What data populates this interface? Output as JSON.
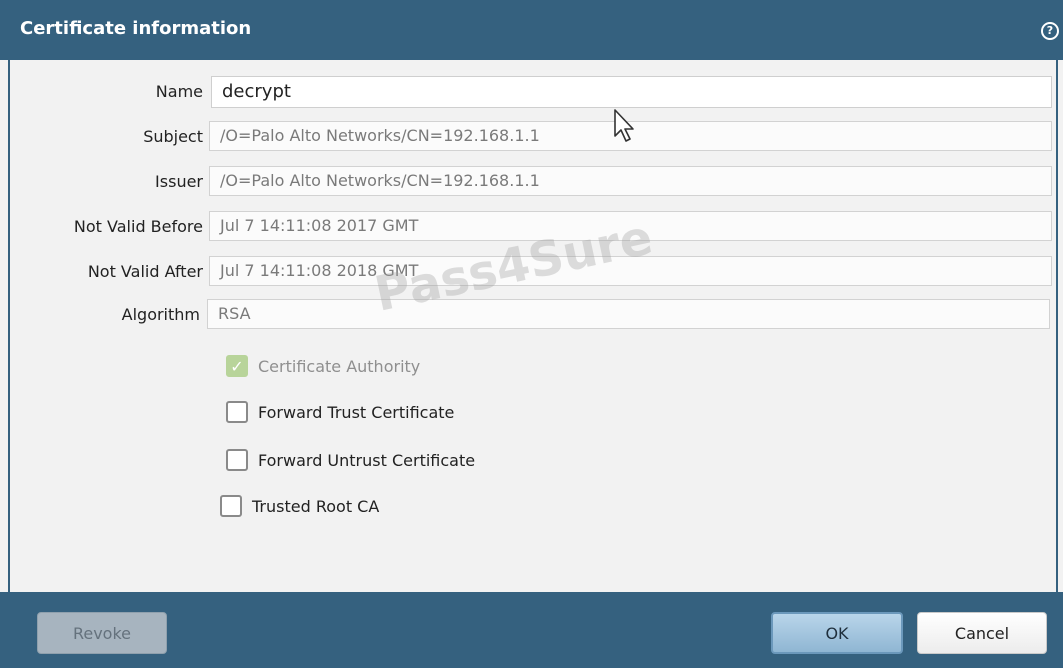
{
  "dialog": {
    "title": "Certificate information",
    "help_icon": "help-circle-icon"
  },
  "fields": {
    "name": {
      "label": "Name",
      "value": "decrypt"
    },
    "subject": {
      "label": "Subject",
      "value": "/O=Palo Alto Networks/CN=192.168.1.1"
    },
    "issuer": {
      "label": "Issuer",
      "value": "/O=Palo Alto Networks/CN=192.168.1.1"
    },
    "not_valid_before": {
      "label": "Not Valid Before",
      "value": "Jul 7 14:11:08 2017 GMT"
    },
    "not_valid_after": {
      "label": "Not Valid After",
      "value": "Jul 7 14:11:08 2018 GMT"
    },
    "algorithm": {
      "label": "Algorithm",
      "value": "RSA"
    }
  },
  "checkboxes": {
    "certificate_authority": {
      "label": "Certificate Authority",
      "checked": true,
      "disabled": true
    },
    "forward_trust": {
      "label": "Forward Trust Certificate",
      "checked": false
    },
    "forward_untrust": {
      "label": "Forward Untrust Certificate",
      "checked": false
    },
    "trusted_root_ca": {
      "label": "Trusted Root CA",
      "checked": false
    }
  },
  "watermark": "Pass4Sure",
  "buttons": {
    "revoke": "Revoke",
    "ok": "OK",
    "cancel": "Cancel"
  },
  "colors": {
    "title_bar": "#35617f",
    "body_bg": "#f2f2f2",
    "checked_disabled": "#b8d49a"
  }
}
